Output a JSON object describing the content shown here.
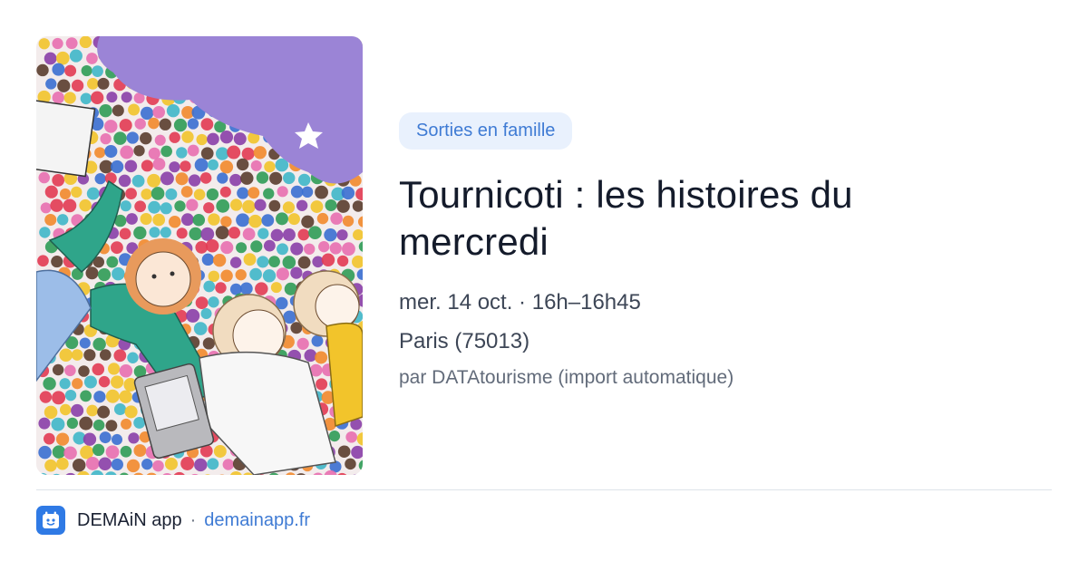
{
  "card": {
    "category": "Sorties en famille",
    "title": "Tournicoti : les histoires du mercredi",
    "date": "mer. 14 oct. · 16h–16h45",
    "location": "Paris (75013)",
    "source": "par DATAtourisme (import automatique)",
    "image": {
      "icon": "illustration-children-reading",
      "palette": [
        "#e23b53",
        "#3a6fd1",
        "#f2c42b",
        "#2f9c57",
        "#8a3fa8",
        "#f28a2c",
        "#3fb7c9",
        "#e86fb0",
        "#5a3d2e"
      ]
    }
  },
  "footer": {
    "app_name": "DEMAiN app",
    "separator": "·",
    "domain": "demainapp.fr",
    "logo_icon": "calendar-face-icon"
  },
  "colors": {
    "badge_bg": "#e9f1fd",
    "accent": "#3f7bd4",
    "logo_bg": "#2f7ae5"
  }
}
